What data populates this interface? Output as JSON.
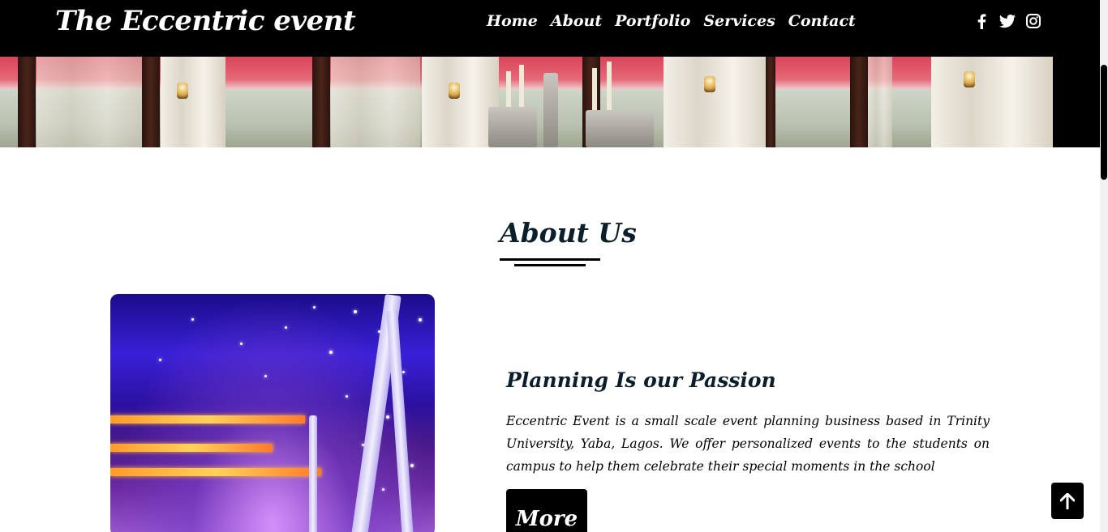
{
  "navbar": {
    "brand": "The Eccentric event",
    "links": [
      "Home",
      "About",
      "Portfolio",
      "Services",
      "Contact"
    ]
  },
  "social": {
    "icons": [
      "facebook-icon",
      "twitter-icon",
      "instagram-icon"
    ]
  },
  "about": {
    "title": "About Us",
    "subtitle": "Planning Is our Passion",
    "description": "Eccentric Event is a small scale event planning business based in Trinity University, Yaba, Lagos. We offer personalized events to the students on campus to help them celebrate their special moments in the school",
    "more_label": "More"
  },
  "controls": {
    "back_to_top_icon": "arrow-up-icon"
  },
  "colors": {
    "navbar_bg": "#000000",
    "heading": "#0b1e2c",
    "button_bg": "#000000"
  }
}
